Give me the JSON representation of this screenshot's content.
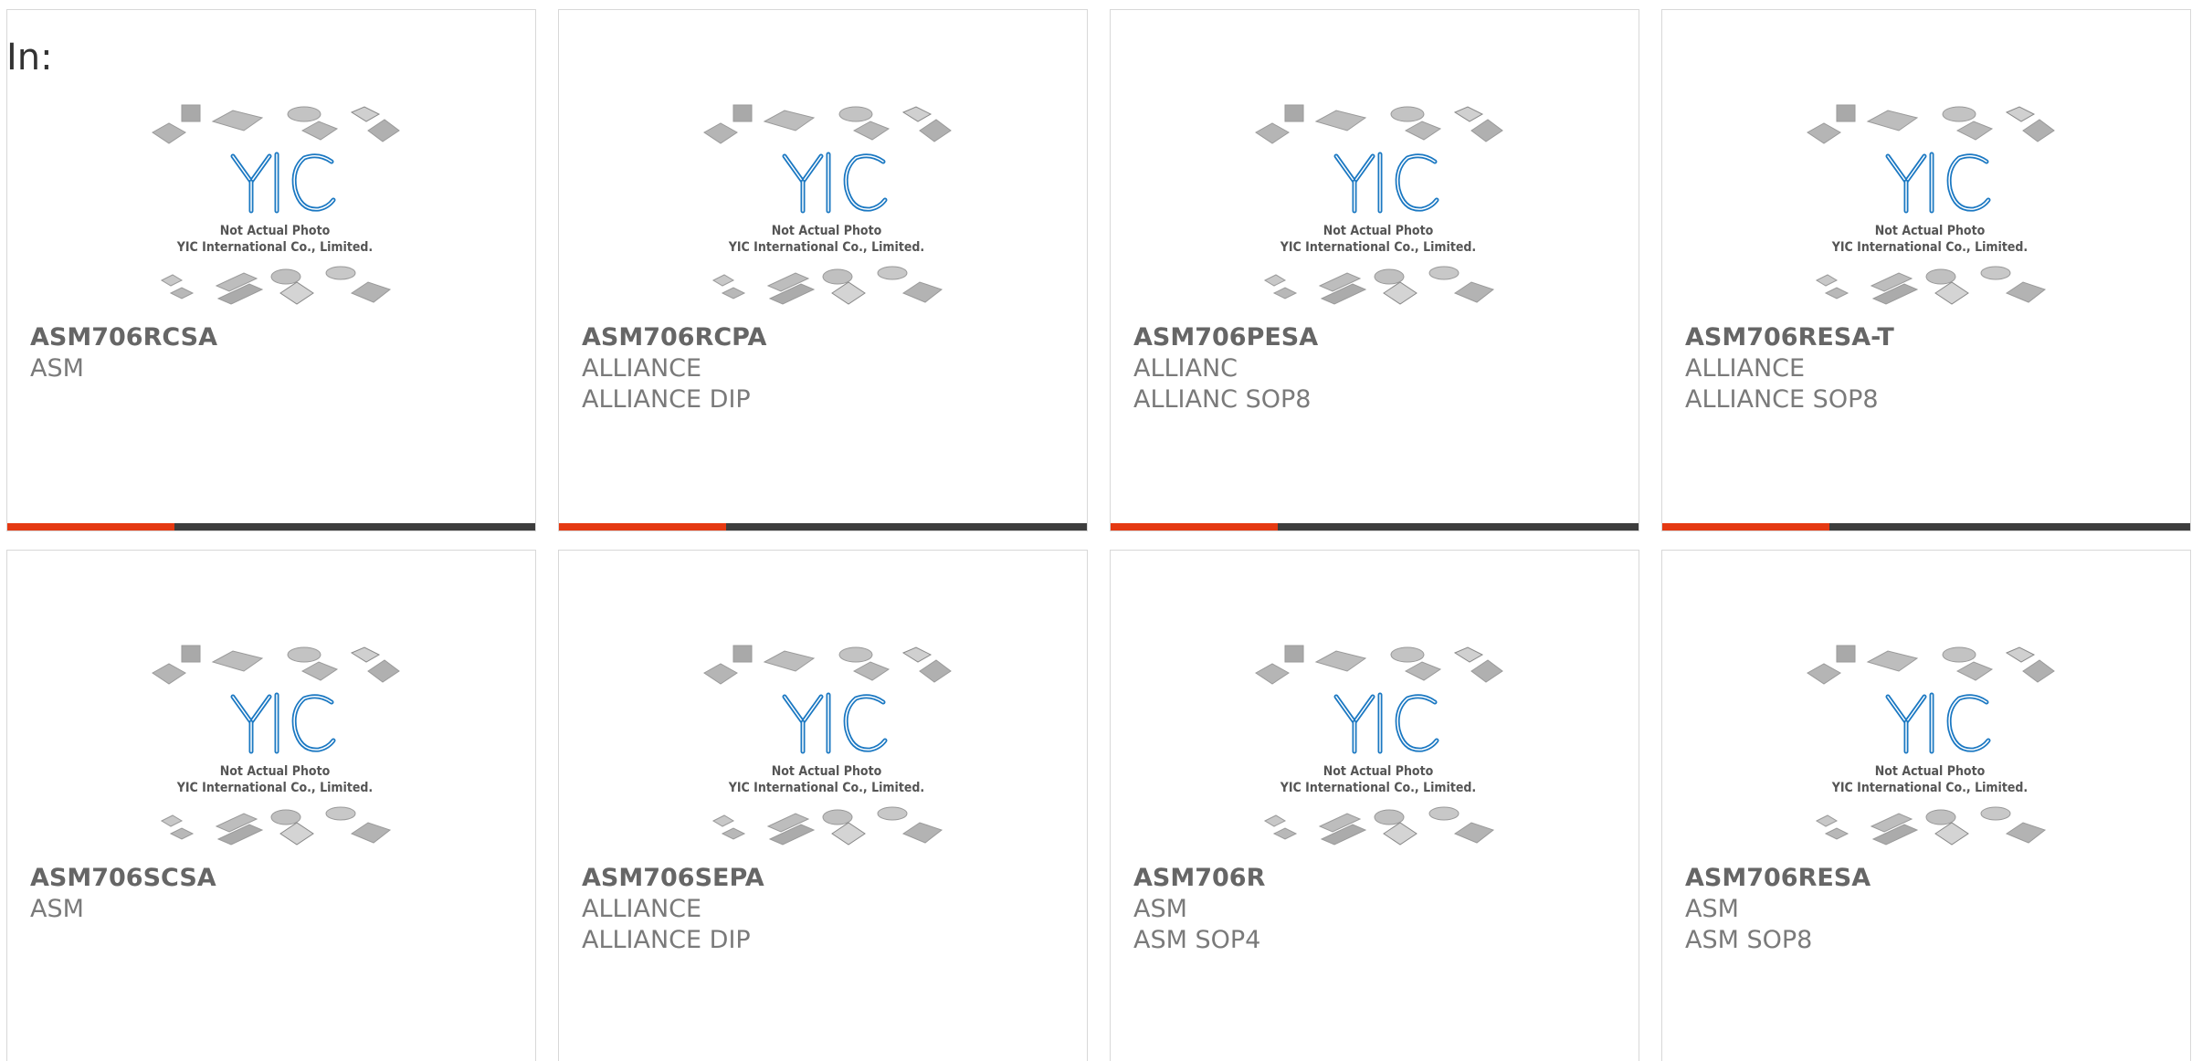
{
  "filter_label": "In:",
  "thumbnail": {
    "line1": "Not Actual Photo",
    "line2": "YIC International Co., Limited.",
    "logo_text": "YIC"
  },
  "colors": {
    "accent": "#e53912",
    "bar": "#3d3d3d",
    "logo_blue": "#1b78c2"
  },
  "products": [
    {
      "part": "ASM706RCSA",
      "maker": "ASM",
      "package": ""
    },
    {
      "part": "ASM706RCPA",
      "maker": "ALLIANCE",
      "package": "ALLIANCE DIP"
    },
    {
      "part": "ASM706PESA",
      "maker": "ALLIANC",
      "package": "ALLIANC SOP8"
    },
    {
      "part": "ASM706RESA-T",
      "maker": "ALLIANCE",
      "package": "ALLIANCE SOP8"
    },
    {
      "part": "ASM706SCSA",
      "maker": "ASM",
      "package": ""
    },
    {
      "part": "ASM706SEPA",
      "maker": "ALLIANCE",
      "package": "ALLIANCE DIP"
    },
    {
      "part": "ASM706R",
      "maker": "ASM",
      "package": "ASM SOP4"
    },
    {
      "part": "ASM706RESA",
      "maker": "ASM",
      "package": "ASM SOP8"
    }
  ]
}
